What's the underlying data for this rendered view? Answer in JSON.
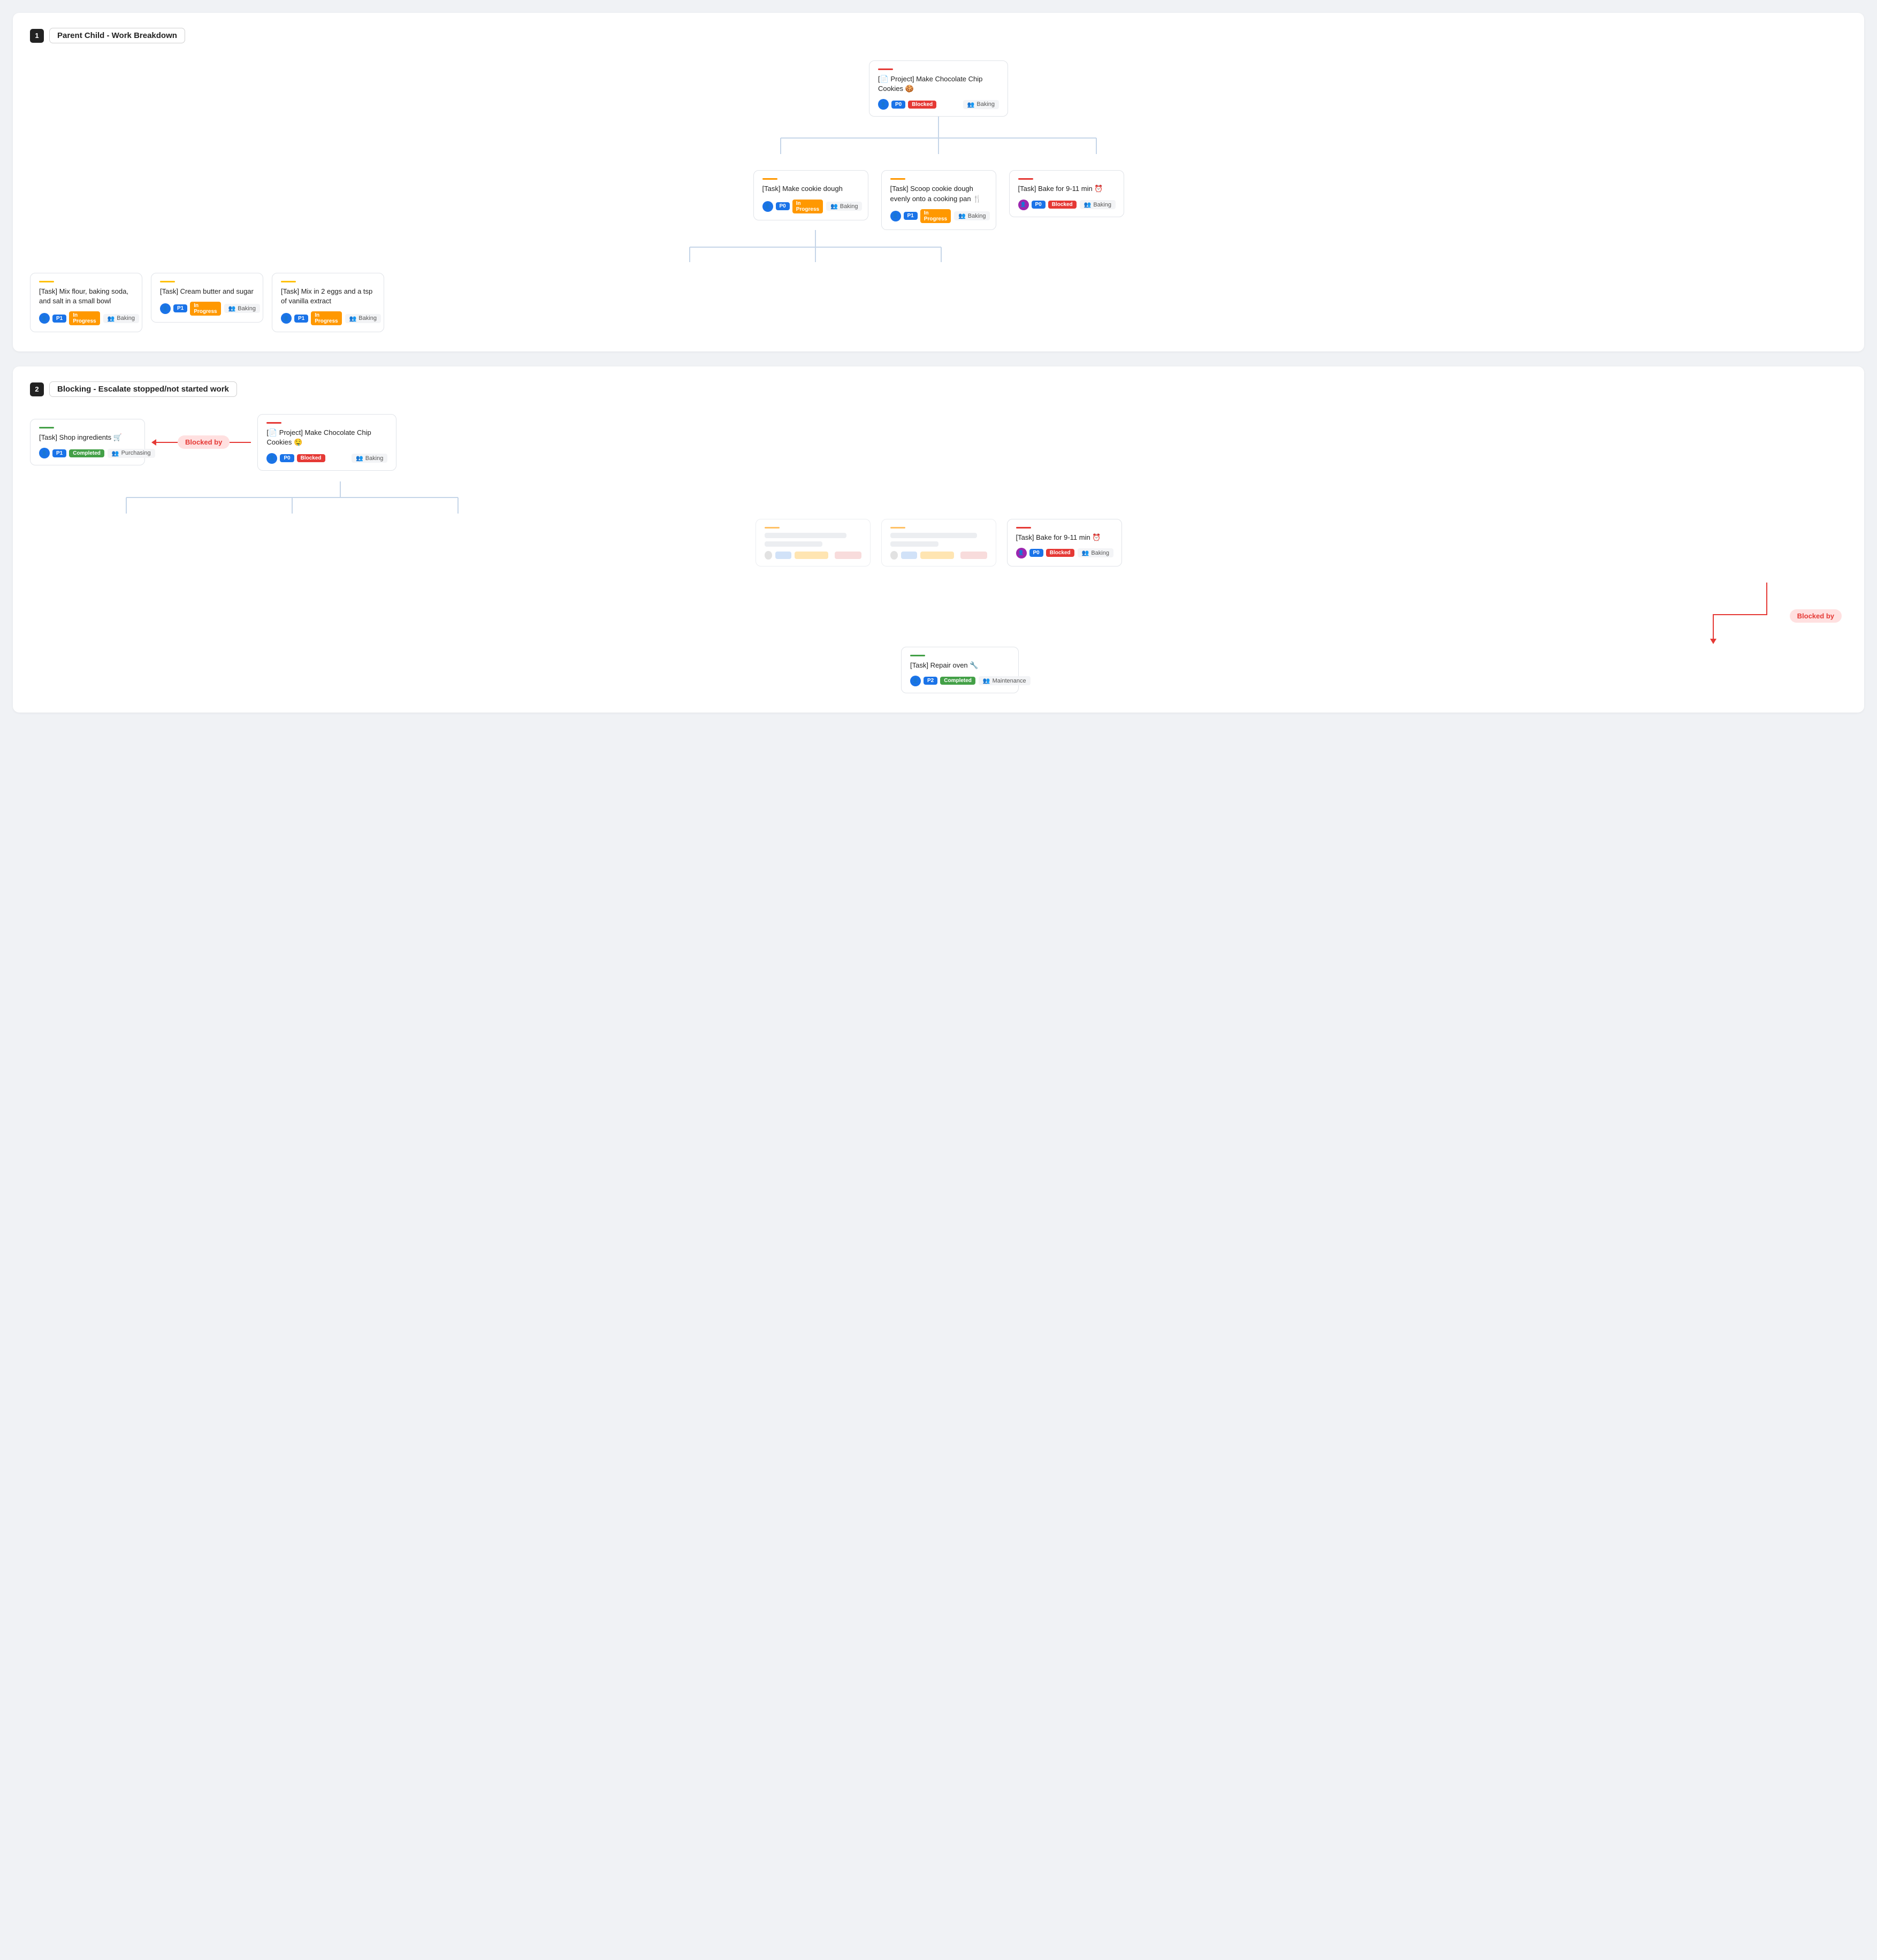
{
  "section1": {
    "number": "1",
    "title": "Parent Child - Work Breakdown",
    "root": {
      "accent": "red",
      "title": "[📄 Project] Make Chocolate Chip Cookies 🍪",
      "priority": "P0",
      "status": "Blocked",
      "team": "Baking",
      "avatar_color": "blue"
    },
    "level1": [
      {
        "accent": "orange",
        "title": "[Task] Make cookie dough",
        "priority": "P0",
        "status": "In Progress",
        "team": "Baking",
        "avatar_color": "blue"
      },
      {
        "accent": "orange",
        "title": "[Task] Scoop cookie dough evenly onto a cooking pan 🍴",
        "priority": "P1",
        "status": "In Progress",
        "team": "Baking",
        "avatar_color": "blue"
      },
      {
        "accent": "red",
        "title": "[Task] Bake for 9-11 min ⏰",
        "priority": "P0",
        "status": "Blocked",
        "team": "Baking",
        "avatar_color": "purple"
      }
    ],
    "level2": [
      {
        "accent": "yellow",
        "title": "[Task] Mix flour, baking soda, and salt in a small bowl",
        "priority": "P1",
        "status": "In Progress",
        "team": "Baking",
        "avatar_color": "blue"
      },
      {
        "accent": "yellow",
        "title": "[Task] Cream butter and sugar",
        "priority": "P1",
        "status": "In Progress",
        "team": "Baking",
        "avatar_color": "blue"
      },
      {
        "accent": "yellow",
        "title": "[Task] Mix in 2 eggs and a tsp of vanilla extract",
        "priority": "P1",
        "status": "In Progress",
        "team": "Baking",
        "avatar_color": "blue"
      }
    ]
  },
  "section2": {
    "number": "2",
    "title": "Blocking - Escalate stopped/not started work",
    "shop": {
      "accent": "green",
      "title": "[Task] Shop ingredients 🛒",
      "priority": "P1",
      "status": "Completed",
      "team": "Purchasing",
      "avatar_color": "blue"
    },
    "blocked_by_label": "Blocked by",
    "root": {
      "accent": "red",
      "title": "[📄 Project] Make Chocolate Chip Cookies 🤤",
      "priority": "P0",
      "status": "Blocked",
      "team": "Baking",
      "avatar_color": "blue"
    },
    "bake": {
      "accent": "red",
      "title": "[Task] Bake for 9-11 min ⏰",
      "priority": "P0",
      "status": "Blocked",
      "team": "Baking",
      "avatar_color": "purple"
    },
    "repair": {
      "accent": "green",
      "title": "[Task] Repair oven 🔧",
      "priority": "P2",
      "status": "Completed",
      "team": "Maintenance",
      "avatar_color": "blue"
    },
    "blocked_by_label2": "Blocked by"
  }
}
